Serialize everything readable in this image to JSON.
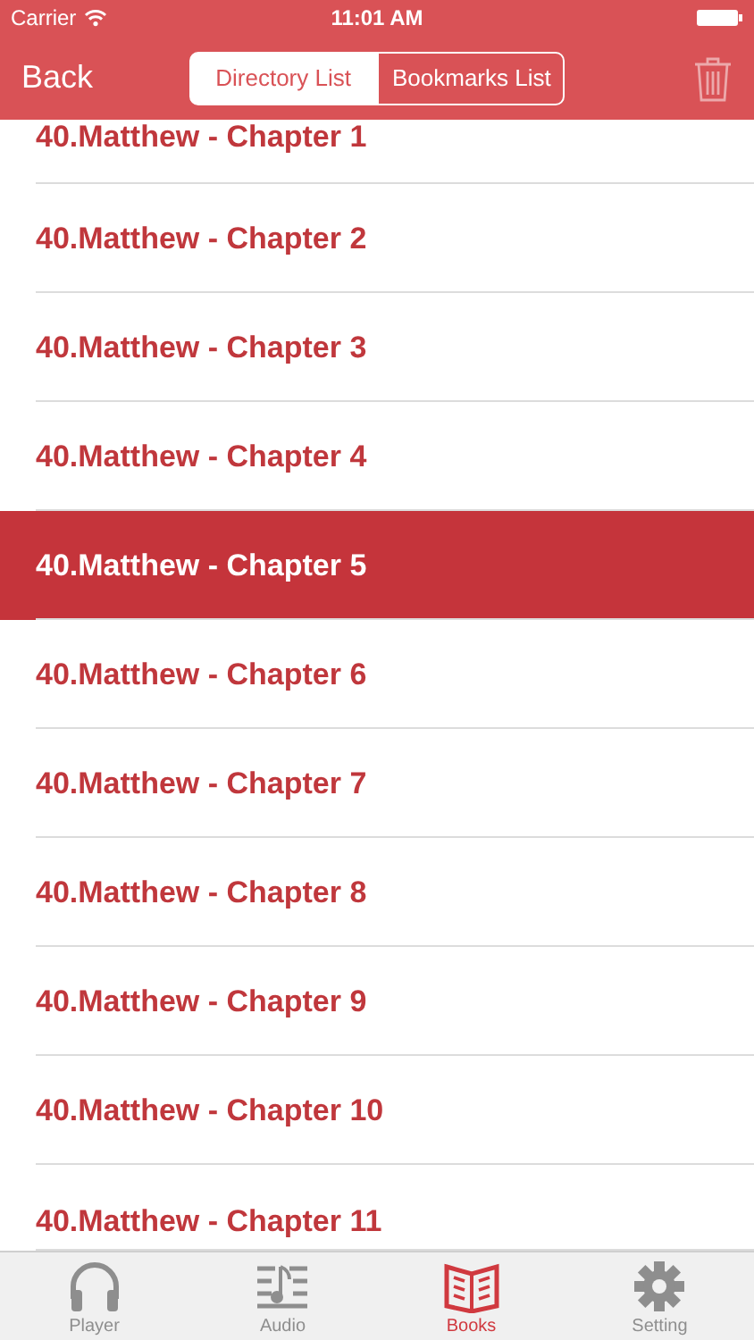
{
  "status_bar": {
    "carrier": "Carrier",
    "time": "11:01 AM"
  },
  "nav": {
    "back": "Back",
    "segments": [
      {
        "label": "Directory List",
        "selected": true
      },
      {
        "label": "Bookmarks List",
        "selected": false
      }
    ]
  },
  "chapters": [
    {
      "title": "40.Matthew - Chapter 1",
      "selected": false
    },
    {
      "title": "40.Matthew - Chapter 2",
      "selected": false
    },
    {
      "title": "40.Matthew - Chapter 3",
      "selected": false
    },
    {
      "title": "40.Matthew - Chapter 4",
      "selected": false
    },
    {
      "title": "40.Matthew - Chapter 5",
      "selected": true
    },
    {
      "title": "40.Matthew - Chapter 6",
      "selected": false
    },
    {
      "title": "40.Matthew - Chapter 7",
      "selected": false
    },
    {
      "title": "40.Matthew - Chapter 8",
      "selected": false
    },
    {
      "title": "40.Matthew - Chapter 9",
      "selected": false
    },
    {
      "title": "40.Matthew - Chapter 10",
      "selected": false
    },
    {
      "title": "40.Matthew - Chapter 11",
      "selected": false
    }
  ],
  "tab_bar": [
    {
      "kind": "player",
      "label": "Player",
      "selected": false
    },
    {
      "kind": "audio",
      "label": "Audio",
      "selected": false
    },
    {
      "kind": "books",
      "label": "Books",
      "selected": true
    },
    {
      "kind": "setting",
      "label": "Setting",
      "selected": false
    }
  ]
}
